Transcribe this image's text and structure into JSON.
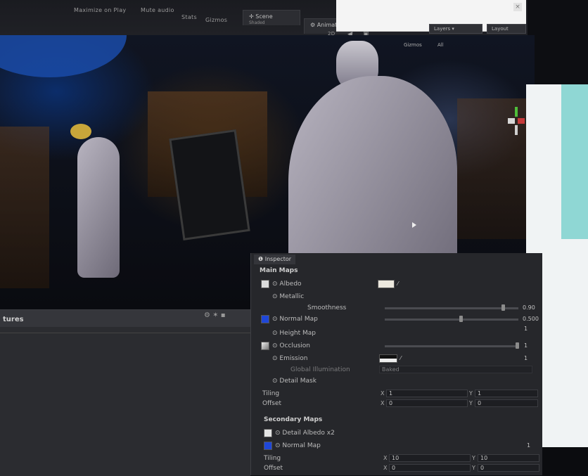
{
  "toolbar": {
    "maximize_on_play": "Maximize on Play",
    "mute_audio": "Mute audio",
    "stats": "Stats",
    "gizmos": "Gizmos",
    "scene_tab": "Scene",
    "scene_sub": "Shaded",
    "animator_tab": "Animator",
    "layers": "Layers",
    "layout": "Layout",
    "view_2d": "2D",
    "gizmos_right": "Gizmos",
    "all_filter": "All"
  },
  "project": {
    "title": "tures"
  },
  "inspector": {
    "tab": "Inspector",
    "main_maps": "Main Maps",
    "albedo": "Albedo",
    "metallic": "Metallic",
    "smoothness": "Smoothness",
    "smoothness_val": "0.90",
    "normal_map": "Normal Map",
    "normal_map_val": "0.500",
    "normal_scale": "1",
    "height_map": "Height Map",
    "occlusion": "Occlusion",
    "occlusion_val": "1",
    "emission": "Emission",
    "emission_val": "1",
    "global_illumination": "Global Illumination",
    "gi_value": "Baked",
    "detail_mask": "Detail Mask",
    "tiling": "Tiling",
    "offset": "Offset",
    "tiling_x": "1",
    "tiling_y": "1",
    "offset_x": "0",
    "offset_y": "0",
    "secondary_maps": "Secondary Maps",
    "detail_albedo": "Detail Albedo x2",
    "normal_map_2": "Normal Map",
    "normal_map_2_val": "1",
    "tiling2": "Tiling",
    "offset2": "Offset",
    "tiling2_x": "10",
    "tiling2_y": "10",
    "offset2_x": "0",
    "offset2_y": "0",
    "x": "X",
    "y": "Y"
  },
  "colors": {
    "accent_blue": "#1f47d8",
    "albedo_swatch": "#e8e4dc"
  }
}
